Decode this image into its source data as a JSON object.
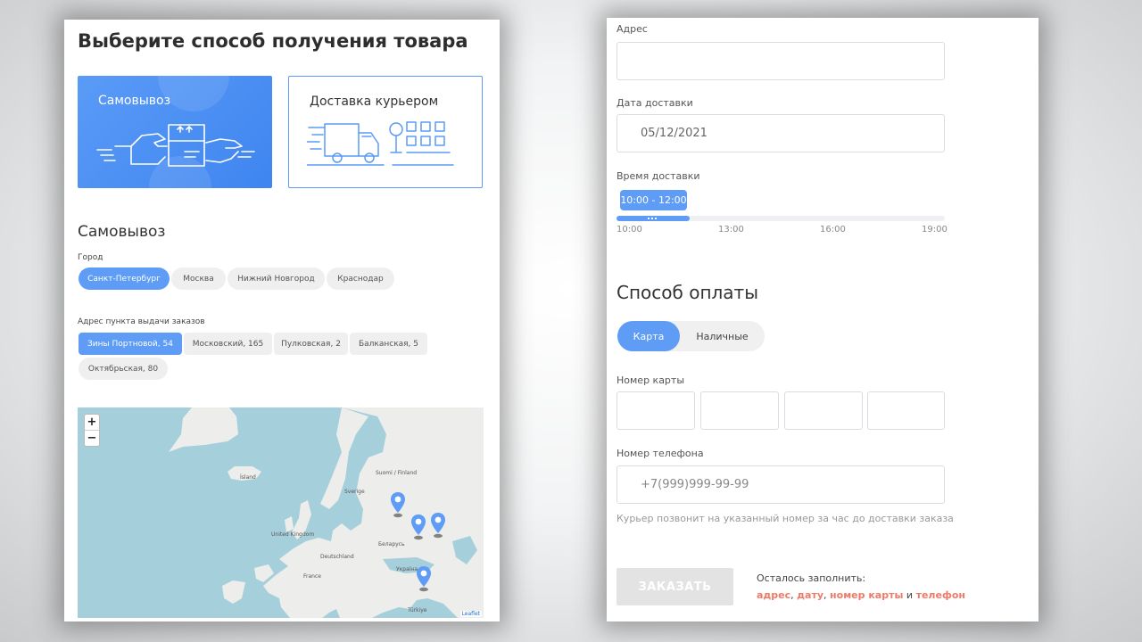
{
  "delivery": {
    "title": "Выберите способ получения товара",
    "methods": [
      {
        "label": "Самовывоз",
        "selected": true
      },
      {
        "label": "Доставка курьером",
        "selected": false
      }
    ]
  },
  "pickup": {
    "section_title": "Самовывоз",
    "city_label": "Город",
    "cities": [
      "Санкт-Петербург",
      "Москва",
      "Нижний Новгород",
      "Краснодар"
    ],
    "selected_city": "Санкт-Петербург",
    "address_label": "Адрес пункта выдачи заказов",
    "addresses": [
      "Зины Портновой, 54",
      "Московский, 165",
      "Пулковская, 2",
      "Балканская, 5",
      "Октябрьская, 80"
    ],
    "selected_address": "Зины Портновой, 54"
  },
  "map": {
    "zoom_in": "+",
    "zoom_out": "−",
    "labels": [
      "Ísland",
      "Suomi / Finland",
      "Sverige",
      "United Kingdom",
      "Беларусь",
      "Deutschland",
      "Україна",
      "France",
      "Türkiye"
    ],
    "attribution": "Leaflet",
    "marker_count": 4
  },
  "courier_form": {
    "address_label": "Адрес",
    "address_value": "",
    "date_label": "Дата доставки",
    "date_value": "05/12/2021",
    "time_label": "Время доставки",
    "time_selected": "10:00 - 12:00",
    "time_ticks": [
      "10:00",
      "13:00",
      "16:00",
      "19:00"
    ]
  },
  "payment": {
    "title": "Способ оплаты",
    "options": [
      "Карта",
      "Наличные"
    ],
    "selected": "Карта",
    "card_number_label": "Номер карты",
    "card_groups": [
      "",
      "",
      "",
      ""
    ],
    "phone_label": "Номер телефона",
    "phone_placeholder": "+7(999)999-99-99",
    "hint": "Курьер позвонит на указанный номер за час до доставки заказа"
  },
  "order": {
    "button_label": "ЗАКАЗАТЬ",
    "remaining_label": "Осталось заполнить:",
    "remaining": {
      "f1": "адрес",
      "sep1": ", ",
      "f2": "дату",
      "sep2": ", ",
      "f3": "номер карты",
      "conj": " и ",
      "f4": "телефон"
    }
  },
  "colors": {
    "accent": "#5e9cf5",
    "missing": "#f07a68",
    "disabled": "#e3e3e3"
  }
}
